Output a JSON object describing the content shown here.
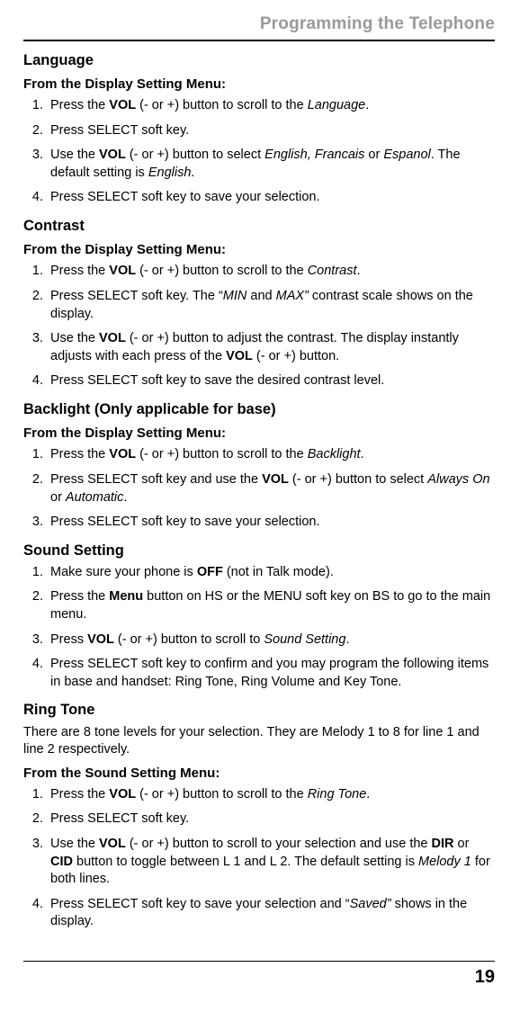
{
  "running_head": "Programming the Telephone",
  "language": {
    "title": "Language",
    "menu_head": "From the Display Setting Menu:",
    "s1_a": "Press the ",
    "s1_b": "VOL",
    "s1_c": " (- or +) button to scroll to the ",
    "s1_d": "Language",
    "s1_e": ".",
    "s2": "Press SELECT soft key.",
    "s3_a": "Use the ",
    "s3_b": "VOL",
    "s3_c": " (- or +) button to select ",
    "s3_d": "English, Francais",
    "s3_e": " or ",
    "s3_f": "Espanol",
    "s3_g": ". The default setting is ",
    "s3_h": "English",
    "s3_i": ".",
    "s4": "Press SELECT soft key to save your selection."
  },
  "contrast": {
    "title": "Contrast",
    "menu_head": "From the Display Setting Menu:",
    "s1_a": "Press the ",
    "s1_b": "VOL",
    "s1_c": " (- or +) button to scroll to the ",
    "s1_d": "Contrast",
    "s1_e": ".",
    "s2_a": "Press SELECT soft key. The “",
    "s2_b": "MIN",
    "s2_c": " and ",
    "s2_d": "MAX”",
    "s2_e": " contrast scale shows on the display.",
    "s3_a": "Use the ",
    "s3_b": "VOL",
    "s3_c": " (- or +) button to adjust the contrast. The display instantly adjusts with each press of the ",
    "s3_d": "VOL",
    "s3_e": " (- or +) button.",
    "s4": "Press SELECT soft key to save the desired contrast level."
  },
  "backlight": {
    "title": "Backlight (Only applicable for base)",
    "menu_head": "From the Display Setting Menu:",
    "s1_a": "Press the ",
    "s1_b": "VOL",
    "s1_c": " (- or +) button to scroll to the ",
    "s1_d": "Backlight",
    "s1_e": ".",
    "s2_a": "Press SELECT soft key and use the ",
    "s2_b": "VOL",
    "s2_c": " (- or +) button to select ",
    "s2_d": "Always On",
    "s2_e": " or ",
    "s2_f": "Automatic",
    "s2_g": ".",
    "s3": "Press SELECT soft key to save your selection."
  },
  "sound": {
    "title": "Sound Setting",
    "s1_a": "Make sure your phone is ",
    "s1_b": "OFF",
    "s1_c": " (not in Talk mode).",
    "s2_a": "Press the ",
    "s2_b": "Menu",
    "s2_c": " button on HS or the MENU soft key on BS to go to the main menu.",
    "s3_a": "Press ",
    "s3_b": "VOL",
    "s3_c": " (- or +) button to scroll to ",
    "s3_d": "Sound Setting",
    "s3_e": ".",
    "s4": "Press SELECT soft key to confirm and you may program the following items in base and handset: Ring Tone, Ring Volume and Key Tone."
  },
  "ring": {
    "title": "Ring Tone",
    "intro": "There are 8 tone levels for your selection. They are Melody 1 to 8 for line 1 and line 2 respectively.",
    "menu_head": "From the Sound Setting Menu:",
    "s1_a": "Press the ",
    "s1_b": "VOL",
    "s1_c": " (- or +) button to scroll to the ",
    "s1_d": "Ring Tone",
    "s1_e": ".",
    "s2": "Press SELECT soft key.",
    "s3_a": "Use the ",
    "s3_b": "VOL",
    "s3_c": " (- or +) button to scroll to your selection and use the ",
    "s3_d": "DIR",
    "s3_e": " or ",
    "s3_f": "CID",
    "s3_g": " button to toggle between L 1 and L 2. The default setting is ",
    "s3_h": "Melody 1",
    "s3_i": " for both lines.",
    "s4_a": "Press SELECT soft key to save your selection and “",
    "s4_b": "Saved”",
    "s4_c": " shows in the display."
  },
  "page_number": "19"
}
